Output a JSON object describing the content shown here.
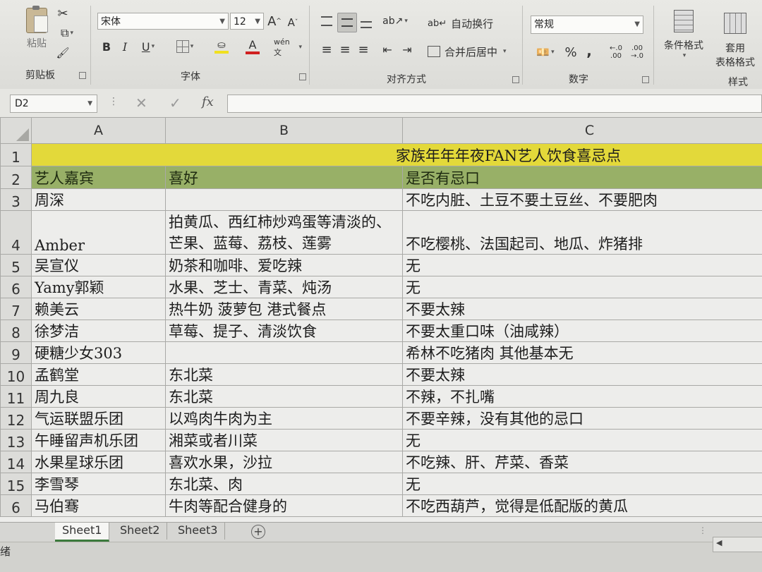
{
  "ribbon": {
    "clipboard": {
      "title": "剪贴板",
      "paste_label": "粘贴"
    },
    "font": {
      "title": "字体",
      "font_name": "宋体",
      "font_size": "12",
      "grow_label": "A",
      "shrink_label": "A",
      "bold": "B",
      "italic": "I",
      "underline": "U",
      "font_color_letter": "A",
      "phonetic": "wén 文"
    },
    "alignment": {
      "title": "对齐方式",
      "wrap_text": "自动换行",
      "merge_center": "合并后居中"
    },
    "number": {
      "title": "数字",
      "format": "常规",
      "percent": "%",
      "comma": ",",
      "inc_decimal": "←.0 .00",
      "dec_decimal": ".00 →.0"
    },
    "styles": {
      "title": "样式",
      "conditional": "条件格式",
      "table_format_1": "套用",
      "table_format_2": "表格格式"
    }
  },
  "formula_bar": {
    "name_box": "D2",
    "fx": "fx",
    "value": ""
  },
  "grid": {
    "columns": [
      "A",
      "B",
      "C"
    ],
    "title": "家族年年年夜FAN艺人饮食喜忌点",
    "headers": [
      "艺人嘉宾",
      "喜好",
      "是否有忌口"
    ],
    "rows": [
      {
        "num": "3",
        "a": "周深",
        "b": "",
        "c": "不吃内脏、土豆不要土豆丝、不要肥肉"
      },
      {
        "num": "4",
        "a": "Amber",
        "b": "拍黄瓜、西红柿炒鸡蛋等清淡的、芒果、蓝莓、荔枝、莲雾",
        "c": "不吃樱桃、法国起司、地瓜、炸猪排"
      },
      {
        "num": "5",
        "a": "吴宣仪",
        "b": "奶茶和咖啡、爱吃辣",
        "c": "无"
      },
      {
        "num": "6",
        "a": "Yamy郭颖",
        "b": "水果、芝士、青菜、炖汤",
        "c": "无"
      },
      {
        "num": "7",
        "a": "赖美云",
        "b": "热牛奶 菠萝包 港式餐点",
        "c": "不要太辣"
      },
      {
        "num": "8",
        "a": "徐梦洁",
        "b": "草莓、提子、清淡饮食",
        "c": "不要太重口味（油咸辣）"
      },
      {
        "num": "9",
        "a": "硬糖少女303",
        "b": "",
        "c": "希林不吃猪肉 其他基本无"
      },
      {
        "num": "10",
        "a": "孟鹤堂",
        "b": "东北菜",
        "c": "不要太辣"
      },
      {
        "num": "11",
        "a": "周九良",
        "b": "东北菜",
        "c": "不辣，不扎嘴"
      },
      {
        "num": "12",
        "a": "气运联盟乐团",
        "b": "以鸡肉牛肉为主",
        "c": "不要辛辣，没有其他的忌口"
      },
      {
        "num": "13",
        "a": "午睡留声机乐团",
        "b": "湘菜或者川菜",
        "c": "无"
      },
      {
        "num": "14",
        "a": "水果星球乐团",
        "b": "喜欢水果，沙拉",
        "c": "不吃辣、肝、芹菜、香菜"
      },
      {
        "num": "15",
        "a": "李雪琴",
        "b": "东北菜、肉",
        "c": "无"
      },
      {
        "num": "6",
        "a": "马伯骞",
        "b": "牛肉等配合健身的",
        "c": "不吃西葫芦，觉得是低配版的黄瓜"
      }
    ]
  },
  "sheets": [
    "Sheet1",
    "Sheet2",
    "Sheet3"
  ],
  "add_sheet": "+",
  "status": "绪",
  "colors": {
    "title_fill": "#e3d93a",
    "header_fill": "#98b067",
    "active_tab_accent": "#3c7a3c"
  }
}
